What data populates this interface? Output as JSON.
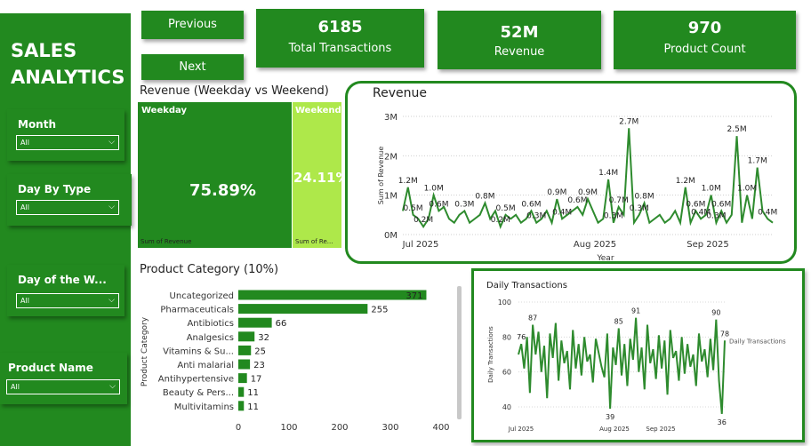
{
  "brand": {
    "line1": "SALES",
    "line2": "ANALYTICS"
  },
  "nav": {
    "previous": "Previous",
    "next": "Next"
  },
  "kpis": [
    {
      "value": "6185",
      "caption": "Total Transactions"
    },
    {
      "value": "52M",
      "caption": "Revenue"
    },
    {
      "value": "970",
      "caption": "Product Count"
    }
  ],
  "slicers": [
    {
      "label": "Month",
      "selected": "All"
    },
    {
      "label": "Day By Type",
      "selected": "All"
    },
    {
      "label": "Day of the W...",
      "selected": "All"
    },
    {
      "label": "Product Name",
      "selected": "All"
    }
  ],
  "weekday_weekend": {
    "title": "Revenue (Weekday vs Weekend)",
    "weekday_label": "Weekday",
    "weekend_label": "Weekend",
    "weekday_pct": "75.89%",
    "weekend_pct": "24.11%",
    "weekday_foot": "Sum of Revenue",
    "weekend_foot": "Sum of Re..."
  },
  "colors": {
    "green": "#22891f",
    "weekend": "#aee84a",
    "line": "#2e8b2e"
  },
  "chart_data": [
    {
      "type": "line",
      "title": "Revenue",
      "xlabel": "Year",
      "ylabel": "Sum of Revenue",
      "ylim": [
        0,
        3000000
      ],
      "y_ticks": [
        "0M",
        "1M",
        "2M",
        "3M"
      ],
      "x_ticks": [
        "Jul 2025",
        "Aug 2025",
        "Sep 2025"
      ],
      "grid": true,
      "values": [
        0.6,
        1.2,
        0.5,
        0.4,
        0.2,
        0.4,
        1.0,
        0.6,
        0.7,
        0.4,
        0.3,
        0.5,
        0.6,
        0.3,
        0.4,
        0.5,
        0.8,
        0.4,
        0.6,
        0.2,
        0.5,
        0.4,
        0.5,
        0.3,
        0.4,
        0.6,
        0.3,
        0.4,
        0.6,
        0.3,
        0.9,
        0.4,
        0.5,
        0.6,
        0.7,
        0.5,
        0.9,
        0.6,
        0.3,
        0.4,
        1.4,
        0.3,
        0.7,
        0.5,
        2.7,
        0.3,
        0.5,
        0.8,
        0.3,
        0.4,
        0.5,
        0.3,
        0.4,
        0.6,
        0.3,
        1.2,
        0.3,
        0.6,
        0.4,
        0.5,
        1.0,
        0.3,
        0.6,
        0.3,
        0.5,
        2.5,
        0.3,
        1.0,
        0.4,
        1.7,
        0.6,
        0.4,
        0.3
      ],
      "data_labels": [
        {
          "i": 1,
          "text": "1.2M"
        },
        {
          "i": 2,
          "text": "0.5M"
        },
        {
          "i": 4,
          "text": "0.2M"
        },
        {
          "i": 6,
          "text": "1.0M"
        },
        {
          "i": 7,
          "text": "0.6M"
        },
        {
          "i": 12,
          "text": "0.3M"
        },
        {
          "i": 16,
          "text": "0.8M"
        },
        {
          "i": 19,
          "text": "0.2M"
        },
        {
          "i": 20,
          "text": "0.5M"
        },
        {
          "i": 25,
          "text": "0.6M"
        },
        {
          "i": 26,
          "text": "0.3M"
        },
        {
          "i": 30,
          "text": "0.9M"
        },
        {
          "i": 31,
          "text": "0.4M"
        },
        {
          "i": 34,
          "text": "0.6M"
        },
        {
          "i": 36,
          "text": "0.9M"
        },
        {
          "i": 40,
          "text": "1.4M"
        },
        {
          "i": 41,
          "text": "0.3M"
        },
        {
          "i": 42,
          "text": "0.7M"
        },
        {
          "i": 44,
          "text": "2.7M"
        },
        {
          "i": 46,
          "text": "0.3M"
        },
        {
          "i": 47,
          "text": "0.8M"
        },
        {
          "i": 55,
          "text": "1.2M"
        },
        {
          "i": 57,
          "text": "0.6M"
        },
        {
          "i": 58,
          "text": "0.4M"
        },
        {
          "i": 60,
          "text": "1.0M"
        },
        {
          "i": 61,
          "text": "0.3M"
        },
        {
          "i": 62,
          "text": "0.6M"
        },
        {
          "i": 65,
          "text": "2.5M"
        },
        {
          "i": 67,
          "text": "1.0M"
        },
        {
          "i": 69,
          "text": "1.7M"
        },
        {
          "i": 71,
          "text": "0.4M"
        }
      ]
    },
    {
      "type": "bar",
      "title": "Product Category (10%)",
      "ylabel": "Product Category",
      "xlabel": "",
      "categories": [
        "Uncategorized",
        "Pharmaceuticals",
        "Antibiotics",
        "Analgesics",
        "Vitamins & Su...",
        "Anti malarial",
        "Antihypertensive",
        "Beauty & Pers...",
        "Multivitamins"
      ],
      "values": [
        371,
        255,
        66,
        32,
        25,
        23,
        17,
        11,
        11
      ],
      "xlim": [
        0,
        400
      ],
      "x_ticks": [
        "0",
        "100",
        "200",
        "300",
        "400"
      ]
    },
    {
      "type": "line",
      "title": "Daily Transactions",
      "ylabel": "Daily Transactions",
      "legend": "Daily Transactions",
      "ylim": [
        40,
        100
      ],
      "y_ticks": [
        "100",
        "80",
        "60",
        "40"
      ],
      "x_ticks": [
        "Jul 2025",
        "Aug 2025",
        "Sep 2025"
      ],
      "values": [
        70,
        76,
        62,
        80,
        48,
        87,
        70,
        83,
        60,
        75,
        45,
        82,
        68,
        88,
        55,
        78,
        65,
        72,
        50,
        84,
        62,
        76,
        58,
        80,
        66,
        70,
        54,
        79,
        71,
        63,
        57,
        82,
        39,
        74,
        64,
        85,
        58,
        76,
        52,
        79,
        67,
        91,
        60,
        74,
        50,
        87,
        65,
        73,
        56,
        81,
        62,
        78,
        47,
        84,
        68,
        72,
        55,
        80,
        59,
        76,
        63,
        70,
        52,
        82,
        66,
        73,
        57,
        79,
        61,
        90,
        55,
        36,
        78
      ],
      "data_labels": [
        {
          "i": 1,
          "text": "76"
        },
        {
          "i": 5,
          "text": "87"
        },
        {
          "i": 32,
          "text": "39"
        },
        {
          "i": 35,
          "text": "85"
        },
        {
          "i": 41,
          "text": "91"
        },
        {
          "i": 69,
          "text": "90"
        },
        {
          "i": 71,
          "text": "36"
        },
        {
          "i": 72,
          "text": "78"
        }
      ]
    }
  ]
}
